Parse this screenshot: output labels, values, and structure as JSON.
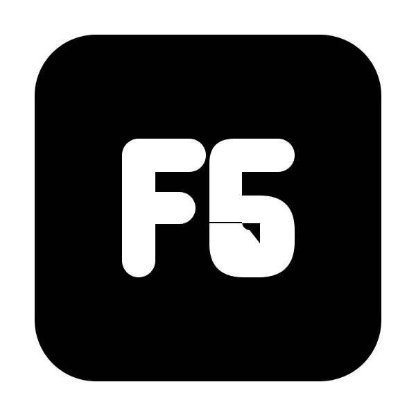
{
  "icon": {
    "name": "f5-key-icon",
    "glyph_text": "F5",
    "background_color": "#ffffff",
    "tile_color": "#000000",
    "glyph_color": "#ffffff"
  }
}
